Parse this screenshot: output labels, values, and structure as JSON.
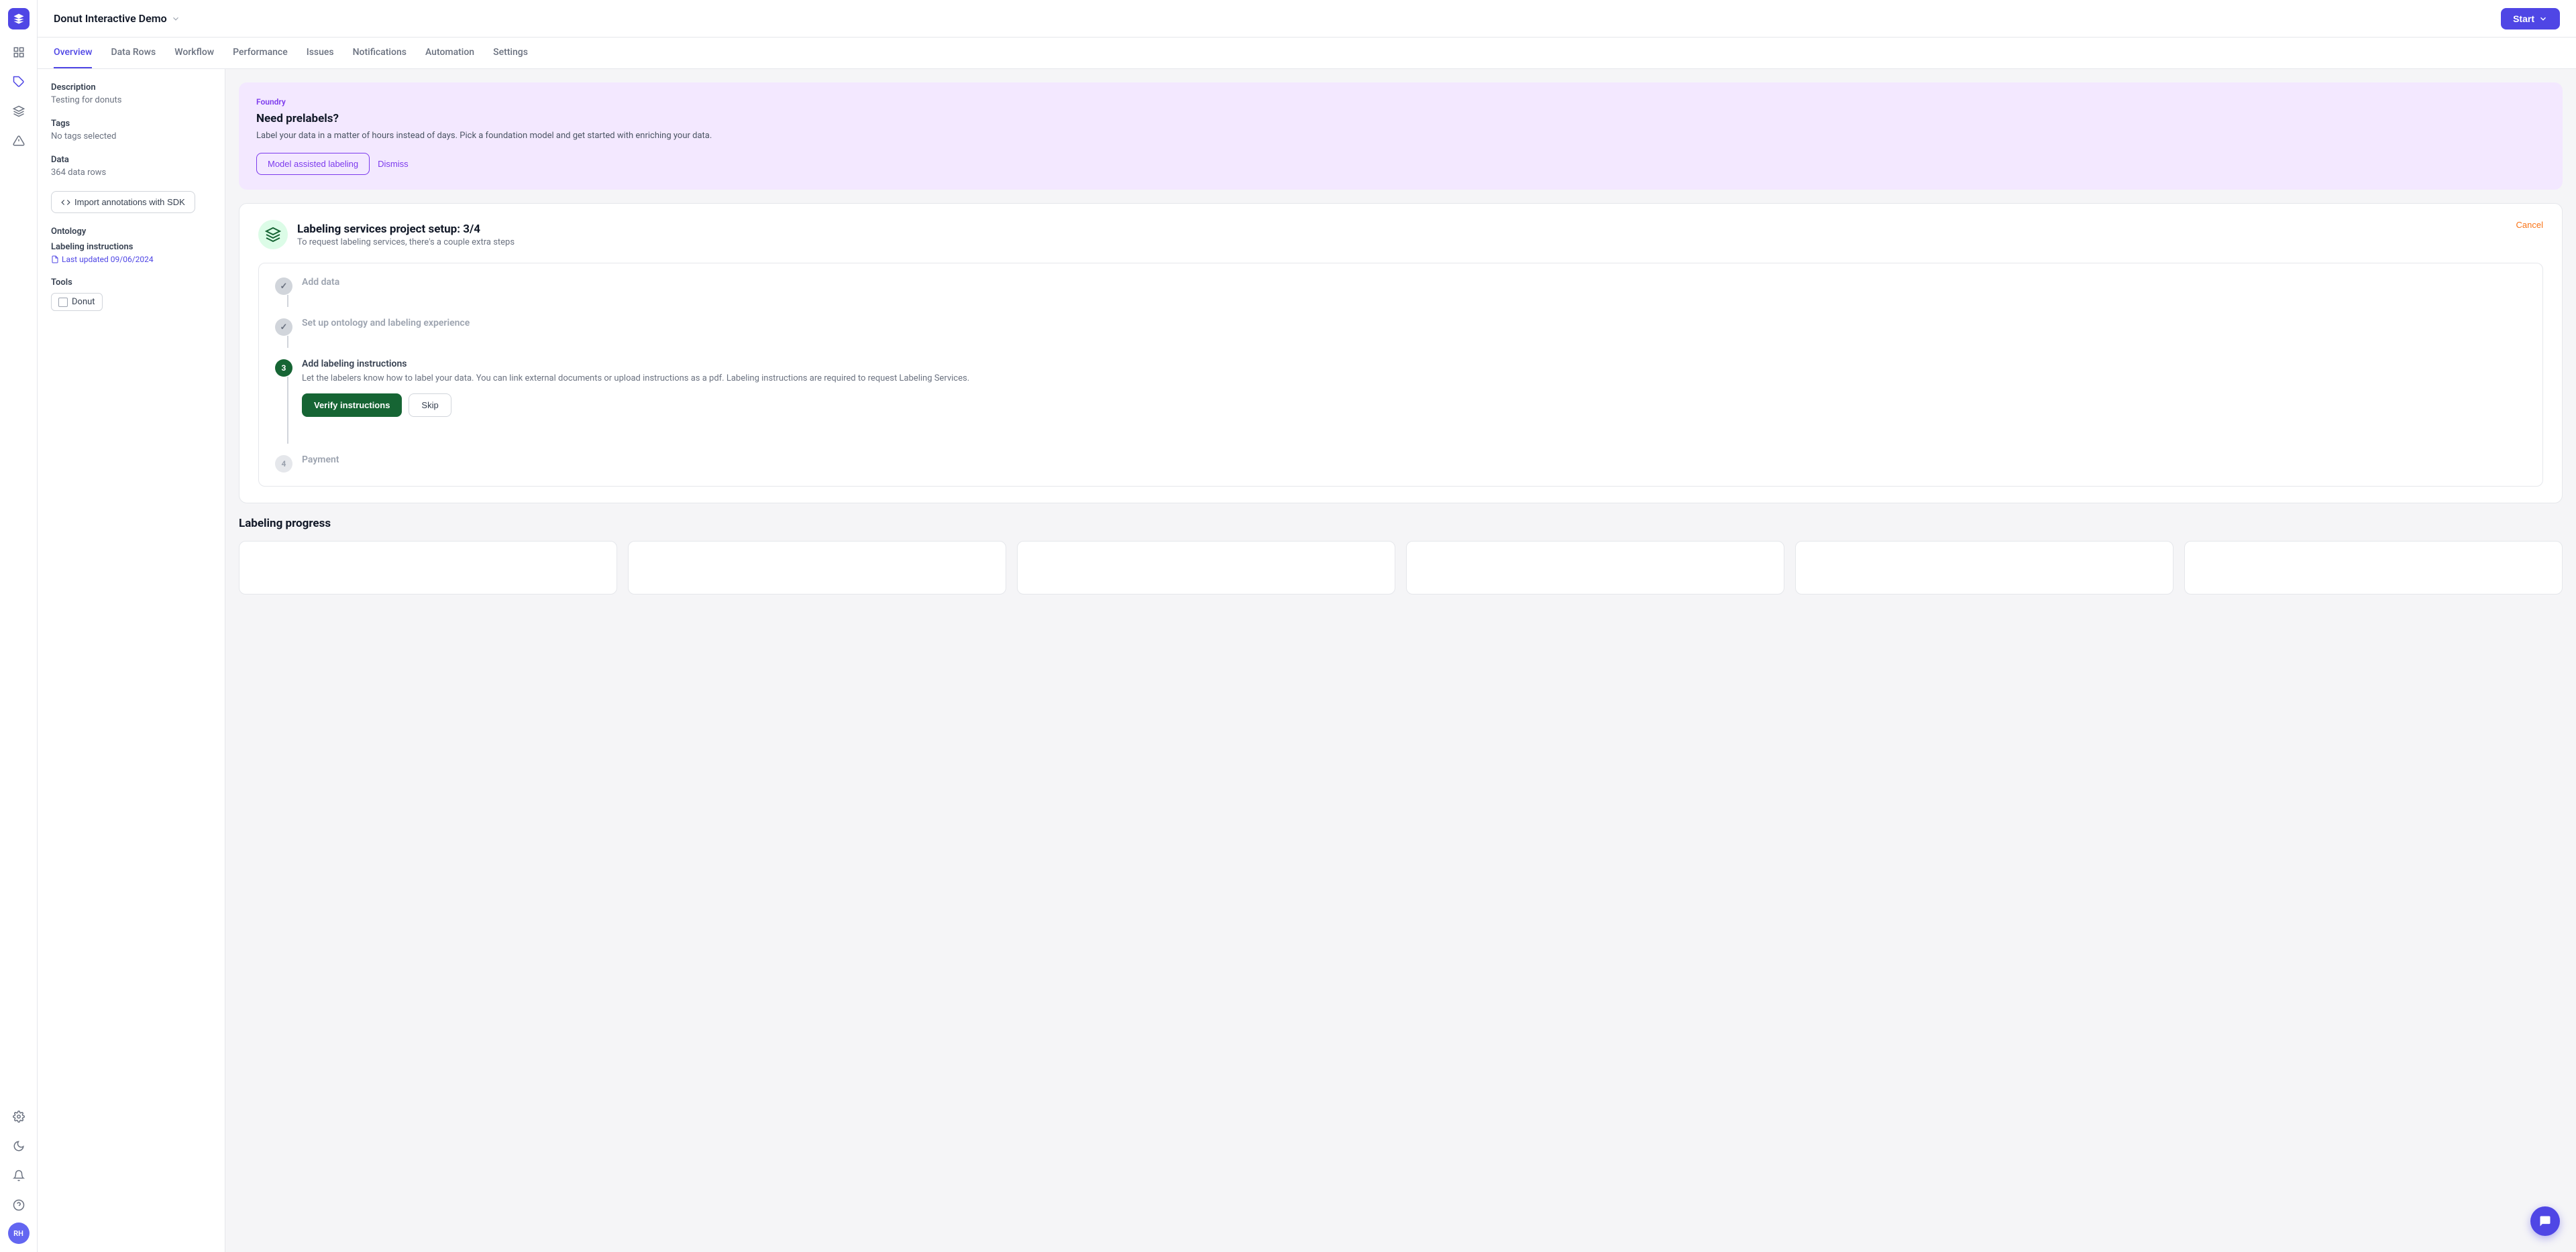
{
  "app": {
    "title": "Donut Interactive Demo",
    "start_btn": "Start"
  },
  "sidebar": {
    "avatar": "RH",
    "icons": [
      {
        "name": "logo-icon",
        "symbol": "◆"
      },
      {
        "name": "grid-icon",
        "symbol": "⊞"
      },
      {
        "name": "tag-icon",
        "symbol": "🏷"
      },
      {
        "name": "layers-icon",
        "symbol": "◈"
      },
      {
        "name": "warning-icon",
        "symbol": "△"
      },
      {
        "name": "settings-icon",
        "symbol": "⚙"
      },
      {
        "name": "moon-icon",
        "symbol": "☽"
      },
      {
        "name": "bell-icon",
        "symbol": "🔔"
      },
      {
        "name": "help-icon",
        "symbol": "?"
      }
    ]
  },
  "nav": {
    "tabs": [
      {
        "label": "Overview",
        "active": true
      },
      {
        "label": "Data Rows",
        "active": false
      },
      {
        "label": "Workflow",
        "active": false
      },
      {
        "label": "Performance",
        "active": false
      },
      {
        "label": "Issues",
        "active": false
      },
      {
        "label": "Notifications",
        "active": false
      },
      {
        "label": "Automation",
        "active": false
      },
      {
        "label": "Settings",
        "active": false
      }
    ]
  },
  "left_panel": {
    "description_label": "Description",
    "description_value": "Testing for donuts",
    "tags_label": "Tags",
    "tags_value": "No tags selected",
    "data_label": "Data",
    "data_value": "364 data rows",
    "import_btn": "Import annotations with SDK",
    "ontology_label": "Ontology",
    "instructions_label": "Labeling instructions",
    "instructions_date": "Last updated 09/06/2024",
    "tools_label": "Tools",
    "tool_name": "Donut"
  },
  "foundry_card": {
    "tag": "Foundry",
    "title": "Need prelabels?",
    "description": "Label your data in a matter of hours instead of days. Pick a foundation model and get started with enriching your data.",
    "model_btn": "Model assisted labeling",
    "dismiss_btn": "Dismiss"
  },
  "setup_card": {
    "title": "Labeling services project setup: 3/4",
    "subtitle": "To request labeling services, there's a couple extra steps",
    "cancel_btn": "Cancel",
    "steps": [
      {
        "id": 1,
        "status": "done",
        "title": "Add data",
        "desc": ""
      },
      {
        "id": 2,
        "status": "done",
        "title": "Set up ontology and labeling experience",
        "desc": ""
      },
      {
        "id": 3,
        "status": "active",
        "title": "Add labeling instructions",
        "desc": "Let the labelers know how to label your data. You can link external documents or upload instructions as a pdf. Labeling instructions are required to request Labeling Services.",
        "verify_btn": "Verify instructions",
        "skip_btn": "Skip"
      },
      {
        "id": 4,
        "status": "pending",
        "title": "Payment",
        "desc": ""
      }
    ]
  },
  "progress": {
    "title": "Labeling progress"
  }
}
